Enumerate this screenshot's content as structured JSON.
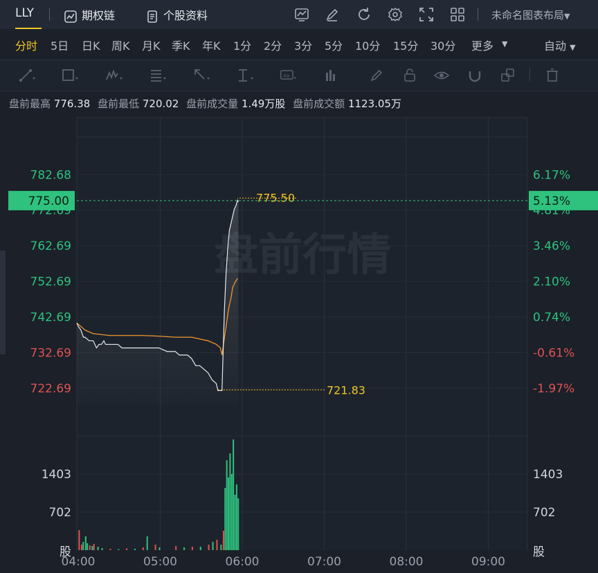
{
  "header": {
    "ticker": "LLY",
    "options_chain": "期权链",
    "stock_profile": "个股资料",
    "layout_name": "未命名图表布局"
  },
  "periods": [
    {
      "label": "分时",
      "active": true
    },
    {
      "label": "5日"
    },
    {
      "label": "日K"
    },
    {
      "label": "周K"
    },
    {
      "label": "月K"
    },
    {
      "label": "季K"
    },
    {
      "label": "年K"
    },
    {
      "label": "1分"
    },
    {
      "label": "2分"
    },
    {
      "label": "3分"
    },
    {
      "label": "5分"
    },
    {
      "label": "10分"
    },
    {
      "label": "15分"
    },
    {
      "label": "30分"
    },
    {
      "label": "更多"
    }
  ],
  "auto_label": "自动",
  "stats": {
    "high_label": "盘前最高",
    "high": "776.38",
    "low_label": "盘前最低",
    "low": "720.02",
    "vol_label": "盘前成交量",
    "vol": "1.49万股",
    "amt_label": "盘前成交额",
    "amt": "1123.05万"
  },
  "watermark": "盘前行情",
  "colors": {
    "up": "#2ec27e",
    "down": "#e05252",
    "accent": "#f2c624",
    "avg_line": "#f0962f",
    "price_line": "#e8eaee"
  },
  "chart_data": {
    "type": "line",
    "price_ticks": [
      {
        "price": "782.68",
        "pct": "6.17%",
        "color": "up"
      },
      {
        "price": "772.69",
        "pct": "4.81%",
        "color": "up"
      },
      {
        "price": "762.69",
        "pct": "3.46%",
        "color": "up"
      },
      {
        "price": "752.69",
        "pct": "2.10%",
        "color": "up"
      },
      {
        "price": "742.69",
        "pct": "0.74%",
        "color": "up"
      },
      {
        "price": "732.69",
        "pct": "-0.61%",
        "color": "down"
      },
      {
        "price": "722.69",
        "pct": "-1.97%",
        "color": "down"
      }
    ],
    "current_price": "775.00",
    "current_pct": "5.13%",
    "high_marker": "775.50",
    "low_marker": "721.83",
    "volume_ticks": [
      "1403",
      "702"
    ],
    "volume_unit": "股",
    "x_ticks": [
      "04:00",
      "05:00",
      "06:00",
      "07:00",
      "08:00",
      "09:00"
    ],
    "price": [
      [
        0,
        741
      ],
      [
        0.02,
        740
      ],
      [
        0.05,
        739
      ],
      [
        0.08,
        737
      ],
      [
        0.1,
        737
      ],
      [
        0.15,
        736
      ],
      [
        0.2,
        736
      ],
      [
        0.24,
        734
      ],
      [
        0.27,
        735
      ],
      [
        0.3,
        735
      ],
      [
        0.33,
        736
      ],
      [
        0.35,
        735
      ],
      [
        0.37,
        735
      ],
      [
        0.4,
        735
      ],
      [
        0.45,
        735
      ],
      [
        0.5,
        735
      ],
      [
        0.55,
        734
      ],
      [
        0.6,
        734
      ],
      [
        0.65,
        734
      ],
      [
        0.7,
        734
      ],
      [
        0.75,
        734
      ],
      [
        0.8,
        734
      ],
      [
        0.85,
        734
      ],
      [
        0.9,
        734
      ],
      [
        0.95,
        734
      ],
      [
        1.0,
        734
      ],
      [
        1.1,
        733
      ],
      [
        1.15,
        733
      ],
      [
        1.2,
        733
      ],
      [
        1.25,
        732
      ],
      [
        1.3,
        732
      ],
      [
        1.35,
        732
      ],
      [
        1.4,
        731
      ],
      [
        1.45,
        729
      ],
      [
        1.5,
        729
      ],
      [
        1.55,
        728
      ],
      [
        1.6,
        727
      ],
      [
        1.65,
        725
      ],
      [
        1.7,
        724
      ],
      [
        1.72,
        722
      ],
      [
        1.75,
        722
      ],
      [
        1.77,
        722
      ],
      [
        1.78,
        730
      ],
      [
        1.8,
        745
      ],
      [
        1.82,
        755
      ],
      [
        1.84,
        762
      ],
      [
        1.86,
        767
      ],
      [
        1.88,
        769
      ],
      [
        1.9,
        771
      ],
      [
        1.92,
        773
      ],
      [
        1.94,
        774
      ],
      [
        1.96,
        775.5
      ],
      [
        1.97,
        775
      ]
    ],
    "avg": [
      [
        0,
        741
      ],
      [
        0.1,
        739
      ],
      [
        0.2,
        738
      ],
      [
        0.4,
        737.5
      ],
      [
        0.6,
        737.5
      ],
      [
        0.8,
        737.5
      ],
      [
        1.0,
        737.3
      ],
      [
        1.2,
        737
      ],
      [
        1.3,
        737
      ],
      [
        1.4,
        737
      ],
      [
        1.5,
        736.5
      ],
      [
        1.6,
        736
      ],
      [
        1.7,
        735
      ],
      [
        1.75,
        734
      ],
      [
        1.77,
        732
      ],
      [
        1.8,
        737
      ],
      [
        1.82,
        740
      ],
      [
        1.85,
        745
      ],
      [
        1.88,
        748
      ],
      [
        1.9,
        751
      ],
      [
        1.93,
        752.5
      ],
      [
        1.96,
        753.5
      ]
    ],
    "volume": [
      [
        0.02,
        290,
        "down"
      ],
      [
        0.05,
        80,
        "down"
      ],
      [
        0.07,
        120,
        "up"
      ],
      [
        0.1,
        200,
        "up"
      ],
      [
        0.12,
        100,
        "up"
      ],
      [
        0.15,
        70,
        "down"
      ],
      [
        0.18,
        60,
        "up"
      ],
      [
        0.2,
        90,
        "down"
      ],
      [
        0.25,
        50,
        "up"
      ],
      [
        0.3,
        30,
        "up"
      ],
      [
        0.4,
        20,
        "down"
      ],
      [
        0.5,
        15,
        "up"
      ],
      [
        0.6,
        25,
        "down"
      ],
      [
        0.7,
        20,
        "up"
      ],
      [
        0.8,
        40,
        "down"
      ],
      [
        0.85,
        200,
        "up"
      ],
      [
        0.95,
        80,
        "down"
      ],
      [
        1.0,
        40,
        "up"
      ],
      [
        1.2,
        60,
        "down"
      ],
      [
        1.3,
        40,
        "up"
      ],
      [
        1.4,
        50,
        "down"
      ],
      [
        1.5,
        50,
        "up"
      ],
      [
        1.6,
        80,
        "down"
      ],
      [
        1.65,
        120,
        "up"
      ],
      [
        1.7,
        150,
        "down"
      ],
      [
        1.75,
        80,
        "up"
      ],
      [
        1.78,
        280,
        "down"
      ],
      [
        1.8,
        900,
        "up"
      ],
      [
        1.82,
        1300,
        "up"
      ],
      [
        1.84,
        1050,
        "up"
      ],
      [
        1.86,
        1400,
        "up"
      ],
      [
        1.88,
        1100,
        "up"
      ],
      [
        1.9,
        1600,
        "up"
      ],
      [
        1.92,
        800,
        "up"
      ],
      [
        1.94,
        950,
        "up"
      ],
      [
        1.96,
        750,
        "up"
      ]
    ],
    "y_price_range": [
      718,
      788
    ],
    "y_volume_max": 1600,
    "x_range": [
      0,
      5.5
    ]
  }
}
